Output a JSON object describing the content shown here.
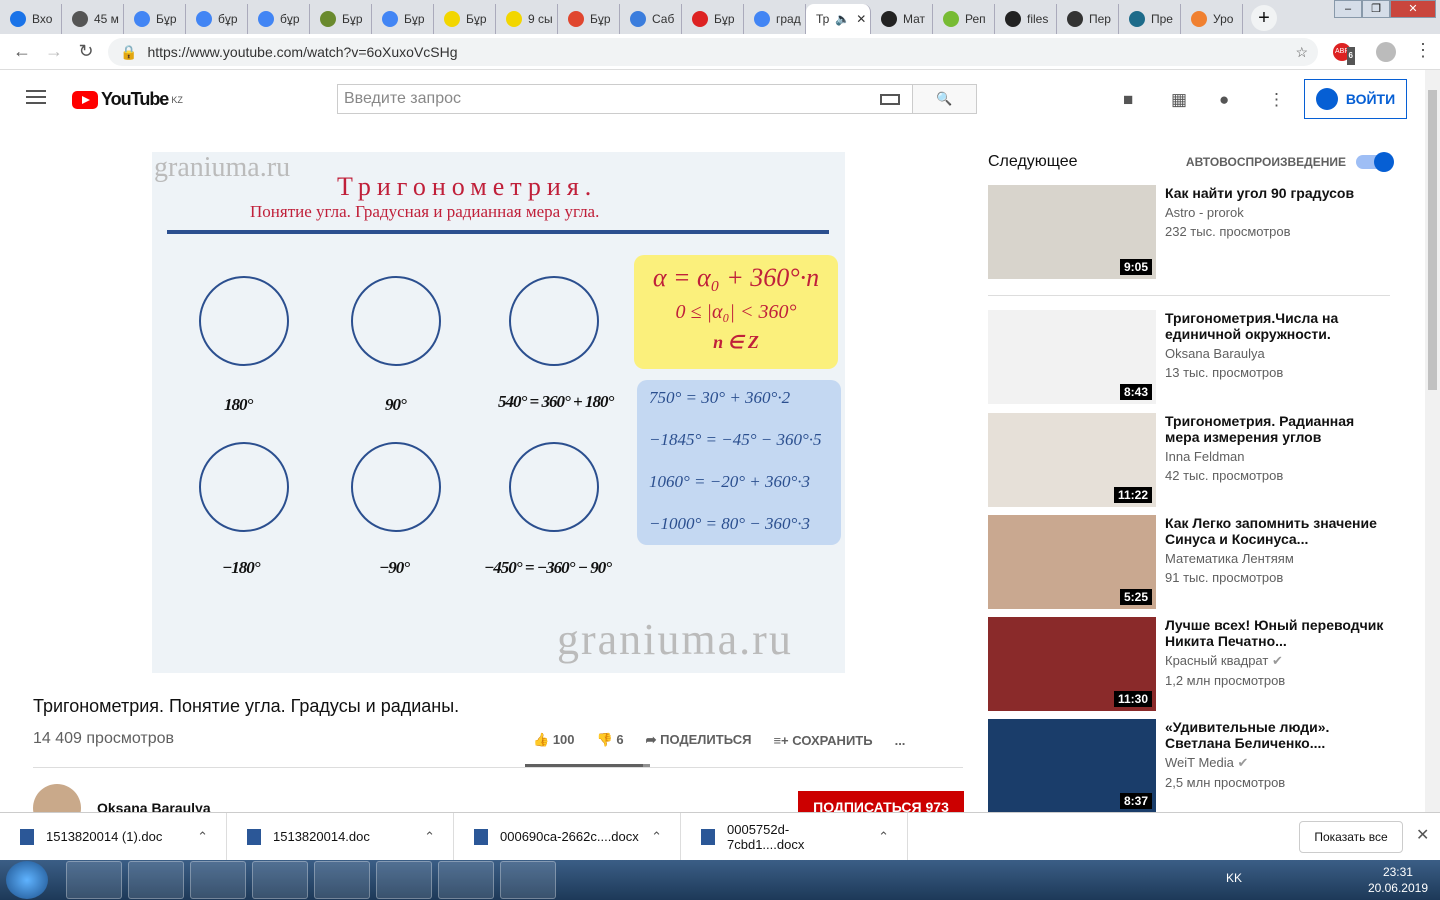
{
  "browser": {
    "tabs": [
      {
        "label": "Вхо",
        "icon": "mail-icon",
        "color": "#1a73e8"
      },
      {
        "label": "45 м",
        "icon": "globe-icon",
        "color": "#555"
      },
      {
        "label": "Бұр",
        "icon": "google-icon",
        "color": "#4285f4"
      },
      {
        "label": "бұр",
        "icon": "google-icon",
        "color": "#4285f4"
      },
      {
        "label": "бұр",
        "icon": "google-icon",
        "color": "#4285f4"
      },
      {
        "label": "Бұр",
        "icon": "seal-icon",
        "color": "#6a8a2e"
      },
      {
        "label": "Бұр",
        "icon": "google-icon",
        "color": "#4285f4"
      },
      {
        "label": "Бұр",
        "icon": "info-icon",
        "color": "#f2d600"
      },
      {
        "label": "9 сы",
        "icon": "info-icon",
        "color": "#f2d600"
      },
      {
        "label": "Бұр",
        "icon": "briefcase-icon",
        "color": "#e0462f"
      },
      {
        "label": "Саб",
        "icon": "u-icon",
        "color": "#3b7ddd"
      },
      {
        "label": "Бұр",
        "icon": "b-icon",
        "color": "#d22"
      },
      {
        "label": "град",
        "icon": "google-icon",
        "color": "#4285f4"
      },
      {
        "label": "Тр",
        "icon": "audio-icon",
        "color": "#fff",
        "active": true
      },
      {
        "label": "Мат",
        "icon": "m-icon",
        "color": "#222"
      },
      {
        "label": "Реп",
        "icon": "pi-icon",
        "color": "#7b3"
      },
      {
        "label": "files",
        "icon": "o-icon",
        "color": "#222"
      },
      {
        "label": "Пер",
        "icon": "clover-icon",
        "color": "#333"
      },
      {
        "label": "Пре",
        "icon": "check-icon",
        "color": "#1d6b8a"
      },
      {
        "label": "Уро",
        "icon": "send-icon",
        "color": "#f08030"
      }
    ],
    "url": "https://www.youtube.com/watch?v=6oXuxoVcSHg",
    "ext_badge": "6"
  },
  "youtube": {
    "region": "KZ",
    "logo_text": "YouTube",
    "search_placeholder": "Введите запрос",
    "login_label": "ВОЙТИ"
  },
  "video_frame": {
    "watermark": "graniuma.ru",
    "title": "Тригонометрия.",
    "subtitle": "Понятие угла. Градусная и радианная мера угла.",
    "angles_top": [
      "180°",
      "90°",
      "540° = 360° + 180°"
    ],
    "angles_bottom": [
      "−180°",
      "−90°",
      "−450° = −360° − 90°"
    ],
    "formula": [
      "α = α₀ + 360°·n",
      "0 ≤ |α₀| < 360°",
      "n ∈ Z"
    ],
    "examples": [
      "750° = 30° + 360°·2",
      "−1845° = −45° − 360°·5",
      "1060° = −20° + 360°·3",
      "−1000° = 80° − 360°·3"
    ]
  },
  "video": {
    "title": "Тригонометрия. Понятие угла. Градусы и радианы.",
    "views": "14 409 просмотров",
    "likes": "100",
    "dislikes": "6",
    "like_ratio": 0.94,
    "share": "ПОДЕЛИТЬСЯ",
    "save": "СОХРАНИТЬ",
    "more": "...",
    "channel": "Oksana Baraulya",
    "subscribe": "ПОДПИСАТЬСЯ 973"
  },
  "sidebar": {
    "heading": "Следующее",
    "autoplay": "АВТОВОСПРОИЗВЕДЕНИЕ",
    "autoplay_on": true,
    "items": [
      {
        "title": "Как найти угол 90 градусов",
        "channel": "Astro - prorok",
        "views": "232 тыс. просмотров",
        "duration": "9:05",
        "color": "#d8d4cc"
      },
      {
        "title": "Тригонометрия.Числа на единичной окружности.",
        "channel": "Oksana Baraulya",
        "views": "13 тыс. просмотров",
        "duration": "8:43",
        "color": "#f2f2f2"
      },
      {
        "title": "Тригонометрия. Радианная мера измерения углов",
        "channel": "Inna Feldman",
        "views": "42 тыс. просмотров",
        "duration": "11:22",
        "color": "#e6e0d8"
      },
      {
        "title": "Как Легко запомнить значение Синуса и Косинуса...",
        "channel": "Математика Лентяям",
        "views": "91 тыс. просмотров",
        "duration": "5:25",
        "color": "#c9a890"
      },
      {
        "title": "Лучше всех! Юный переводчик Никита Печатно...",
        "channel": "Красный квадрат",
        "views": "1,2 млн просмотров",
        "duration": "11:30",
        "color": "#8a2a2a",
        "verified": true
      },
      {
        "title": "«Удивительные люди». Светлана Беличенко....",
        "channel": "WeiT Media",
        "views": "2,5 млн просмотров",
        "duration": "8:37",
        "color": "#1a3d6a",
        "verified": true
      }
    ]
  },
  "downloads": {
    "items": [
      "1513820014 (1).doc",
      "1513820014.doc",
      "000690ca-2662c....docx",
      "0005752d-7cbd1....docx"
    ],
    "show_all": "Показать все"
  },
  "taskbar": {
    "lang": "KK",
    "time": "23:31",
    "date": "20.06.2019"
  }
}
